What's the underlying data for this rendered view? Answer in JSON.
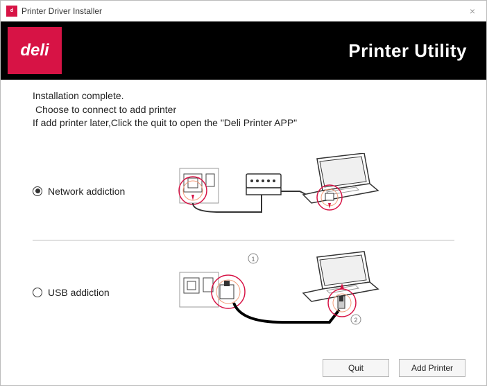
{
  "window": {
    "title": "Printer Driver Installer",
    "close": "×"
  },
  "banner": {
    "logo_text": "deli",
    "title": "Printer Utility"
  },
  "message": {
    "line1": "Installation complete.",
    "line2": "Choose to connect to add printer",
    "line3": "If add printer later,Click the quit to open the \"Deli Printer APP\""
  },
  "options": {
    "network": {
      "label": "Network addiction",
      "selected": true
    },
    "usb": {
      "label": "USB addiction",
      "selected": false
    }
  },
  "buttons": {
    "quit": "Quit",
    "add": "Add Printer"
  }
}
